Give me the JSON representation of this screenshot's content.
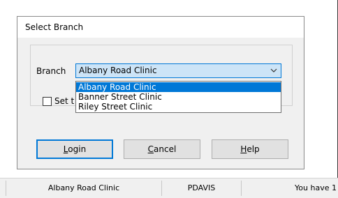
{
  "dialog": {
    "title": "Select Branch",
    "branch_label": "Branch",
    "combo_value": "Albany Road Clinic",
    "options": [
      "Albany Road Clinic",
      "Banner Street Clinic",
      "Riley Street Clinic"
    ],
    "checkbox_label_visible": "Set t",
    "buttons": {
      "login_first": "L",
      "login_rest": "ogin",
      "cancel_first": "C",
      "cancel_rest": "ancel",
      "help_first": "H",
      "help_rest": "elp"
    }
  },
  "statusbar": {
    "branch": "Albany Road Clinic",
    "user": "PDAVIS",
    "message": "You have 1"
  },
  "colors": {
    "selection": "#0078d7",
    "combo_highlight": "#cce4f7"
  },
  "icons": [
    "chevron-down-icon"
  ]
}
